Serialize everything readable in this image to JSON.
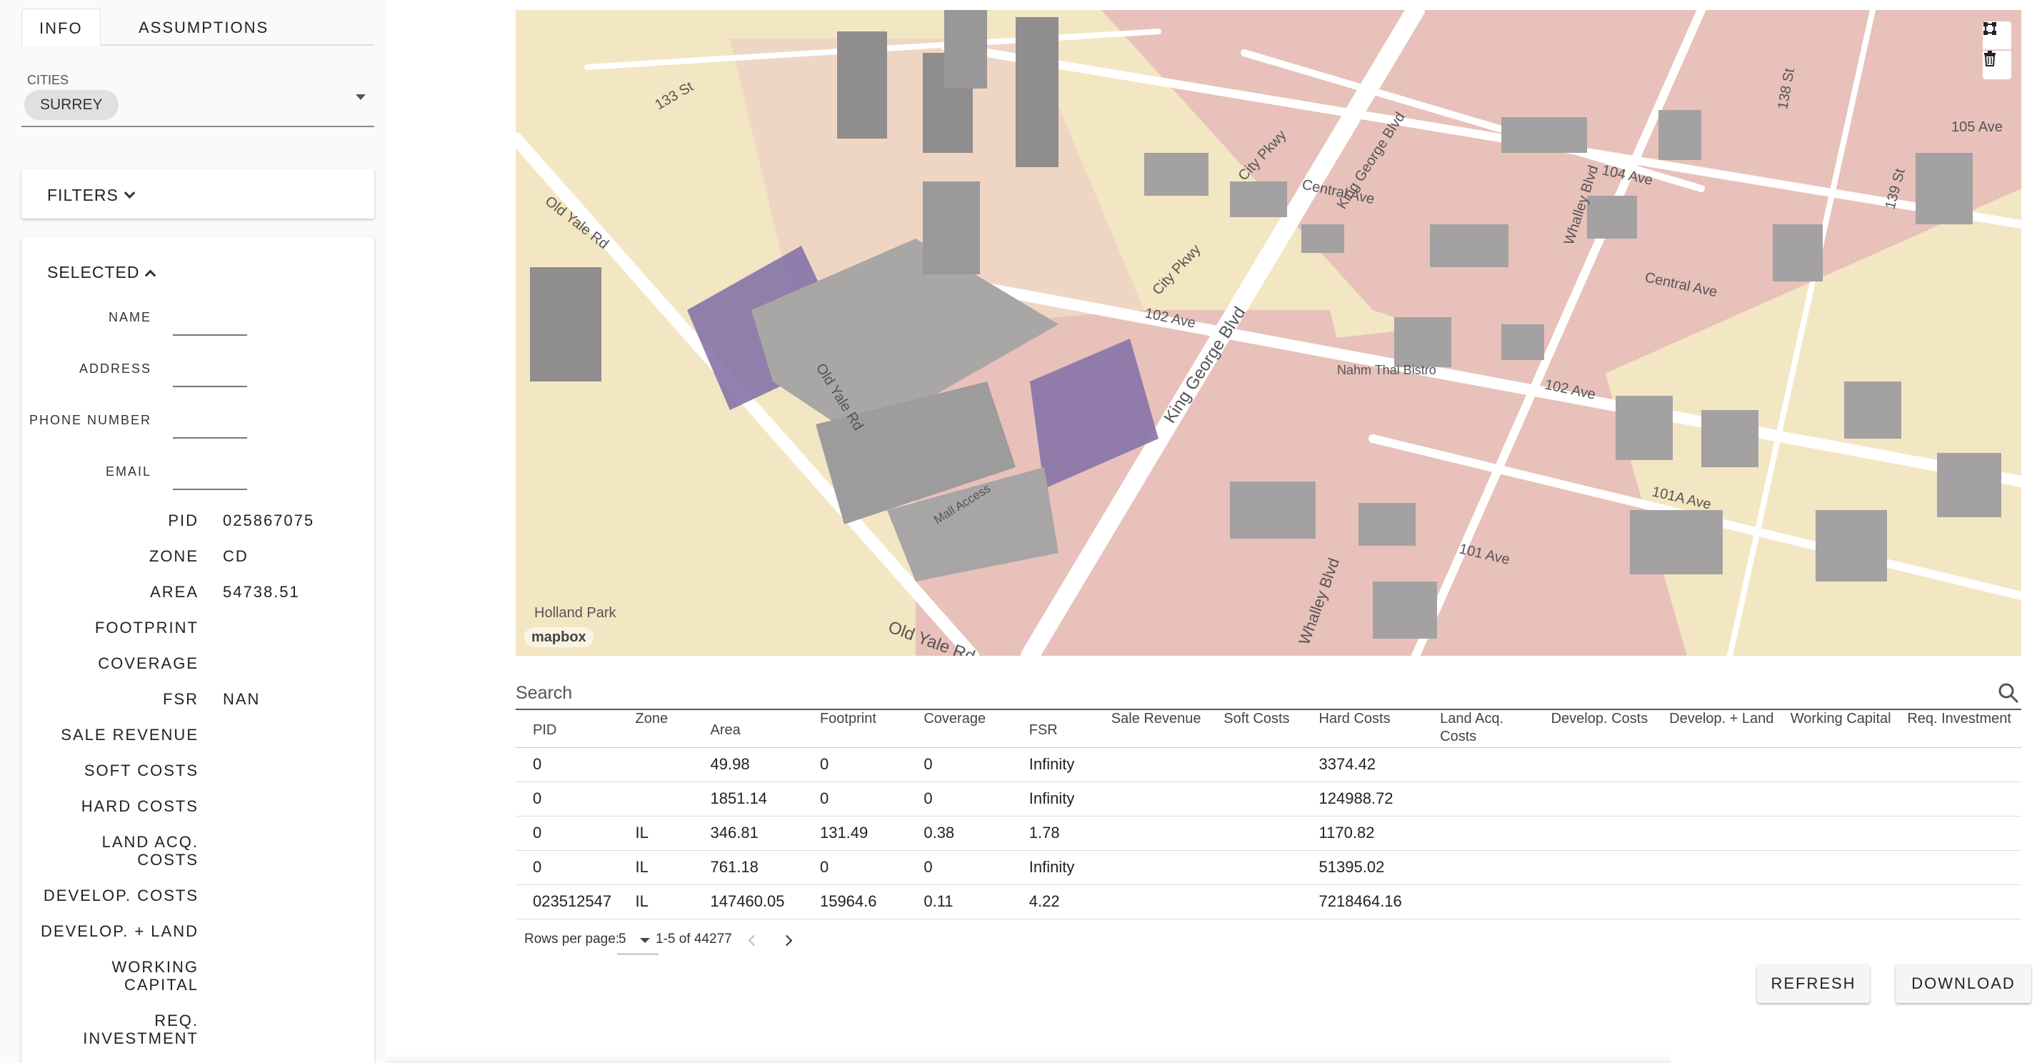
{
  "sidebar": {
    "tabs": [
      {
        "label": "INFO"
      },
      {
        "label": "ASSUMPTIONS"
      }
    ],
    "cities": {
      "label": "CITIES",
      "selected": "SURREY"
    },
    "filters": {
      "label": "FILTERS"
    },
    "selected": {
      "label": "SELECTED",
      "fields": [
        {
          "label": "NAME",
          "value": ""
        },
        {
          "label": "ADDRESS",
          "value": ""
        },
        {
          "label": "PHONE NUMBER",
          "value": ""
        },
        {
          "label": "EMAIL",
          "value": ""
        }
      ],
      "properties": [
        {
          "label": "PID",
          "value": "025867075"
        },
        {
          "label": "ZONE",
          "value": "CD"
        },
        {
          "label": "AREA",
          "value": "54738.51"
        },
        {
          "label": "FOOTPRINT",
          "value": ""
        },
        {
          "label": "COVERAGE",
          "value": ""
        },
        {
          "label": "FSR",
          "value": "NAN"
        },
        {
          "label": "SALE REVENUE",
          "value": ""
        },
        {
          "label": "SOFT COSTS",
          "value": ""
        },
        {
          "label": "HARD COSTS",
          "value": ""
        },
        {
          "label": "LAND ACQ. COSTS",
          "value": ""
        },
        {
          "label": "DEVELOP. COSTS",
          "value": ""
        },
        {
          "label": "DEVELOP. + LAND",
          "value": ""
        },
        {
          "label": "WORKING CAPITAL",
          "value": ""
        },
        {
          "label": "REQ. INVESTMENT",
          "value": ""
        }
      ]
    }
  },
  "map": {
    "attribution": "mapbox",
    "street_labels": [
      "Old Yale Rd",
      "Old Yale Rd",
      "Old Yale Rd",
      "King George Blvd",
      "King George Blvd",
      "City Pkwy",
      "City Pkwy",
      "Central Ave",
      "Central Ave",
      "102 Ave",
      "102 Ave",
      "101A Ave",
      "101 Ave",
      "Whalley Blvd",
      "Whalley Blvd",
      "104 Ave",
      "Holland Park",
      "Mall Access",
      "Nahm Thai Bistro",
      "133 St",
      "138 St",
      "139 St",
      "105 Ave"
    ],
    "colors": {
      "land": "#f3e6c2",
      "commercial": "#e8c1bb",
      "road": "#ffffff",
      "building": "#9d9b9b",
      "selected": "#8673a8"
    },
    "controls": [
      "draw-polygon-icon",
      "trash-icon"
    ]
  },
  "table": {
    "search_placeholder": "Search",
    "columns": [
      "PID",
      "Zone",
      "Area",
      "Footprint",
      "Coverage",
      "FSR",
      "Sale Revenue",
      "Soft Costs",
      "Hard Costs",
      "Land Acq. Costs",
      "Develop. Costs",
      "Develop. + Land",
      "Working Capital",
      "Req. Investment"
    ],
    "rows": [
      [
        "0",
        "",
        "49.98",
        "0",
        "0",
        "Infinity",
        "",
        "",
        "3374.42",
        "",
        "",
        "",
        "",
        ""
      ],
      [
        "0",
        "",
        "1851.14",
        "0",
        "0",
        "Infinity",
        "",
        "",
        "124988.72",
        "",
        "",
        "",
        "",
        ""
      ],
      [
        "0",
        "IL",
        "346.81",
        "131.49",
        "0.38",
        "1.78",
        "",
        "",
        "1170.82",
        "",
        "",
        "",
        "",
        ""
      ],
      [
        "0",
        "IL",
        "761.18",
        "0",
        "0",
        "Infinity",
        "",
        "",
        "51395.02",
        "",
        "",
        "",
        "",
        ""
      ],
      [
        "023512547",
        "IL",
        "147460.05",
        "15964.6",
        "0.11",
        "4.22",
        "",
        "",
        "7218464.16",
        "",
        "",
        "",
        "",
        ""
      ]
    ],
    "pagination": {
      "rows_per_page_label": "Rows per page:",
      "rows_per_page": "5",
      "range": "1-5 of 44277"
    }
  },
  "actions": {
    "refresh": "REFRESH",
    "download": "DOWNLOAD"
  }
}
